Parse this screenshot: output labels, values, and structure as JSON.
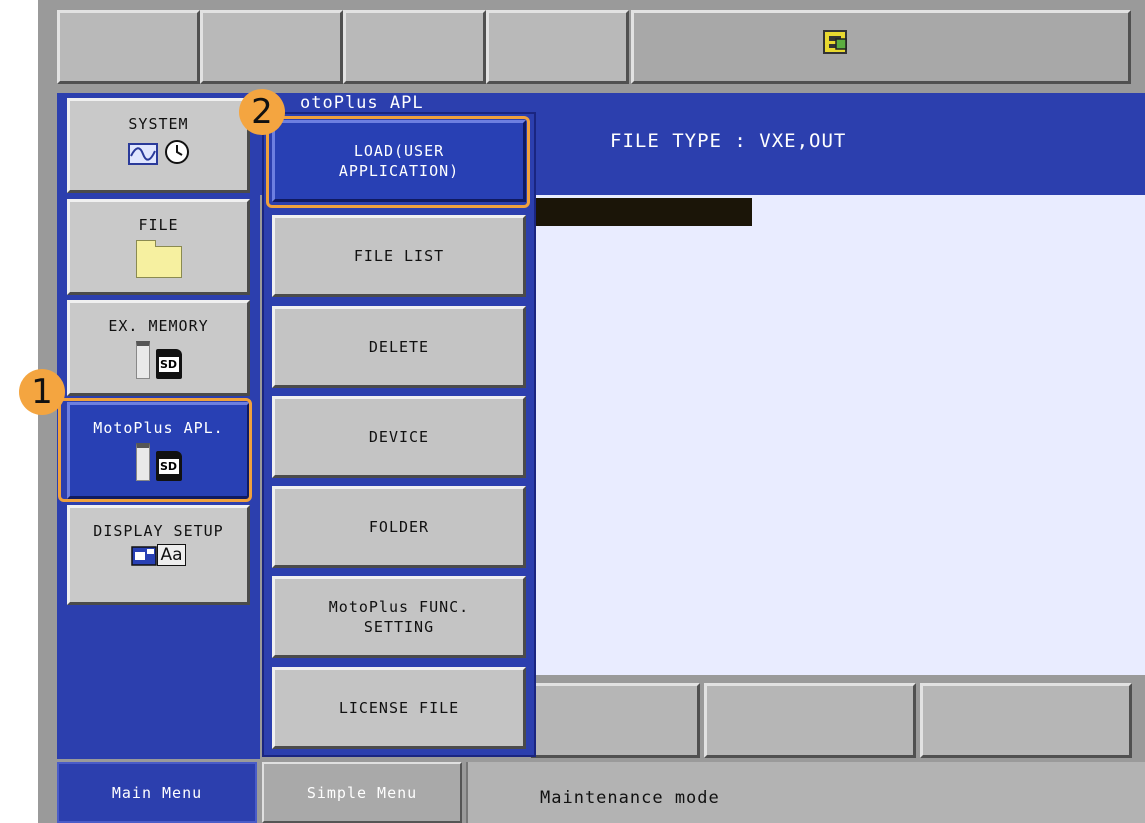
{
  "status_bar": {
    "cells": [
      "",
      "",
      "",
      "",
      ""
    ],
    "icon": "security-key-icon"
  },
  "main_menu": {
    "items": [
      {
        "label": "SYSTEM",
        "icons": [
          "waveform-icon",
          "clock-icon"
        ]
      },
      {
        "label": "FILE",
        "icons": [
          "folder-icon"
        ]
      },
      {
        "label": "EX. MEMORY",
        "icons": [
          "usb-icon",
          "sd-card-icon"
        ]
      },
      {
        "label": "MotoPlus APL.",
        "icons": [
          "usb-icon",
          "sd-card-icon"
        ],
        "active": true
      },
      {
        "label": "DISPLAY SETUP",
        "icons": [
          "window-icon",
          "font-icon"
        ]
      }
    ],
    "sd_label": "SD",
    "font_label": "Aa"
  },
  "submenu": {
    "items": [
      {
        "label": "LOAD(USER\n APPLICATION)",
        "active": true
      },
      {
        "label": "FILE LIST"
      },
      {
        "label": "DELETE"
      },
      {
        "label": "DEVICE"
      },
      {
        "label": "FOLDER"
      },
      {
        "label": "MotoPlus FUNC.\n SETTING"
      },
      {
        "label": "LICENSE FILE"
      }
    ]
  },
  "content": {
    "partial_title": "otoPlus APL",
    "file_type": "FILE TYPE : VXE,OUT"
  },
  "bottom_bar": {
    "main_menu": "Main Menu",
    "simple_menu": "Simple Menu",
    "status": "Maintenance mode"
  },
  "callouts": {
    "one": "1",
    "two": "2"
  },
  "colors": {
    "accent": "#2c3fae",
    "highlight": "#f0a13d"
  }
}
